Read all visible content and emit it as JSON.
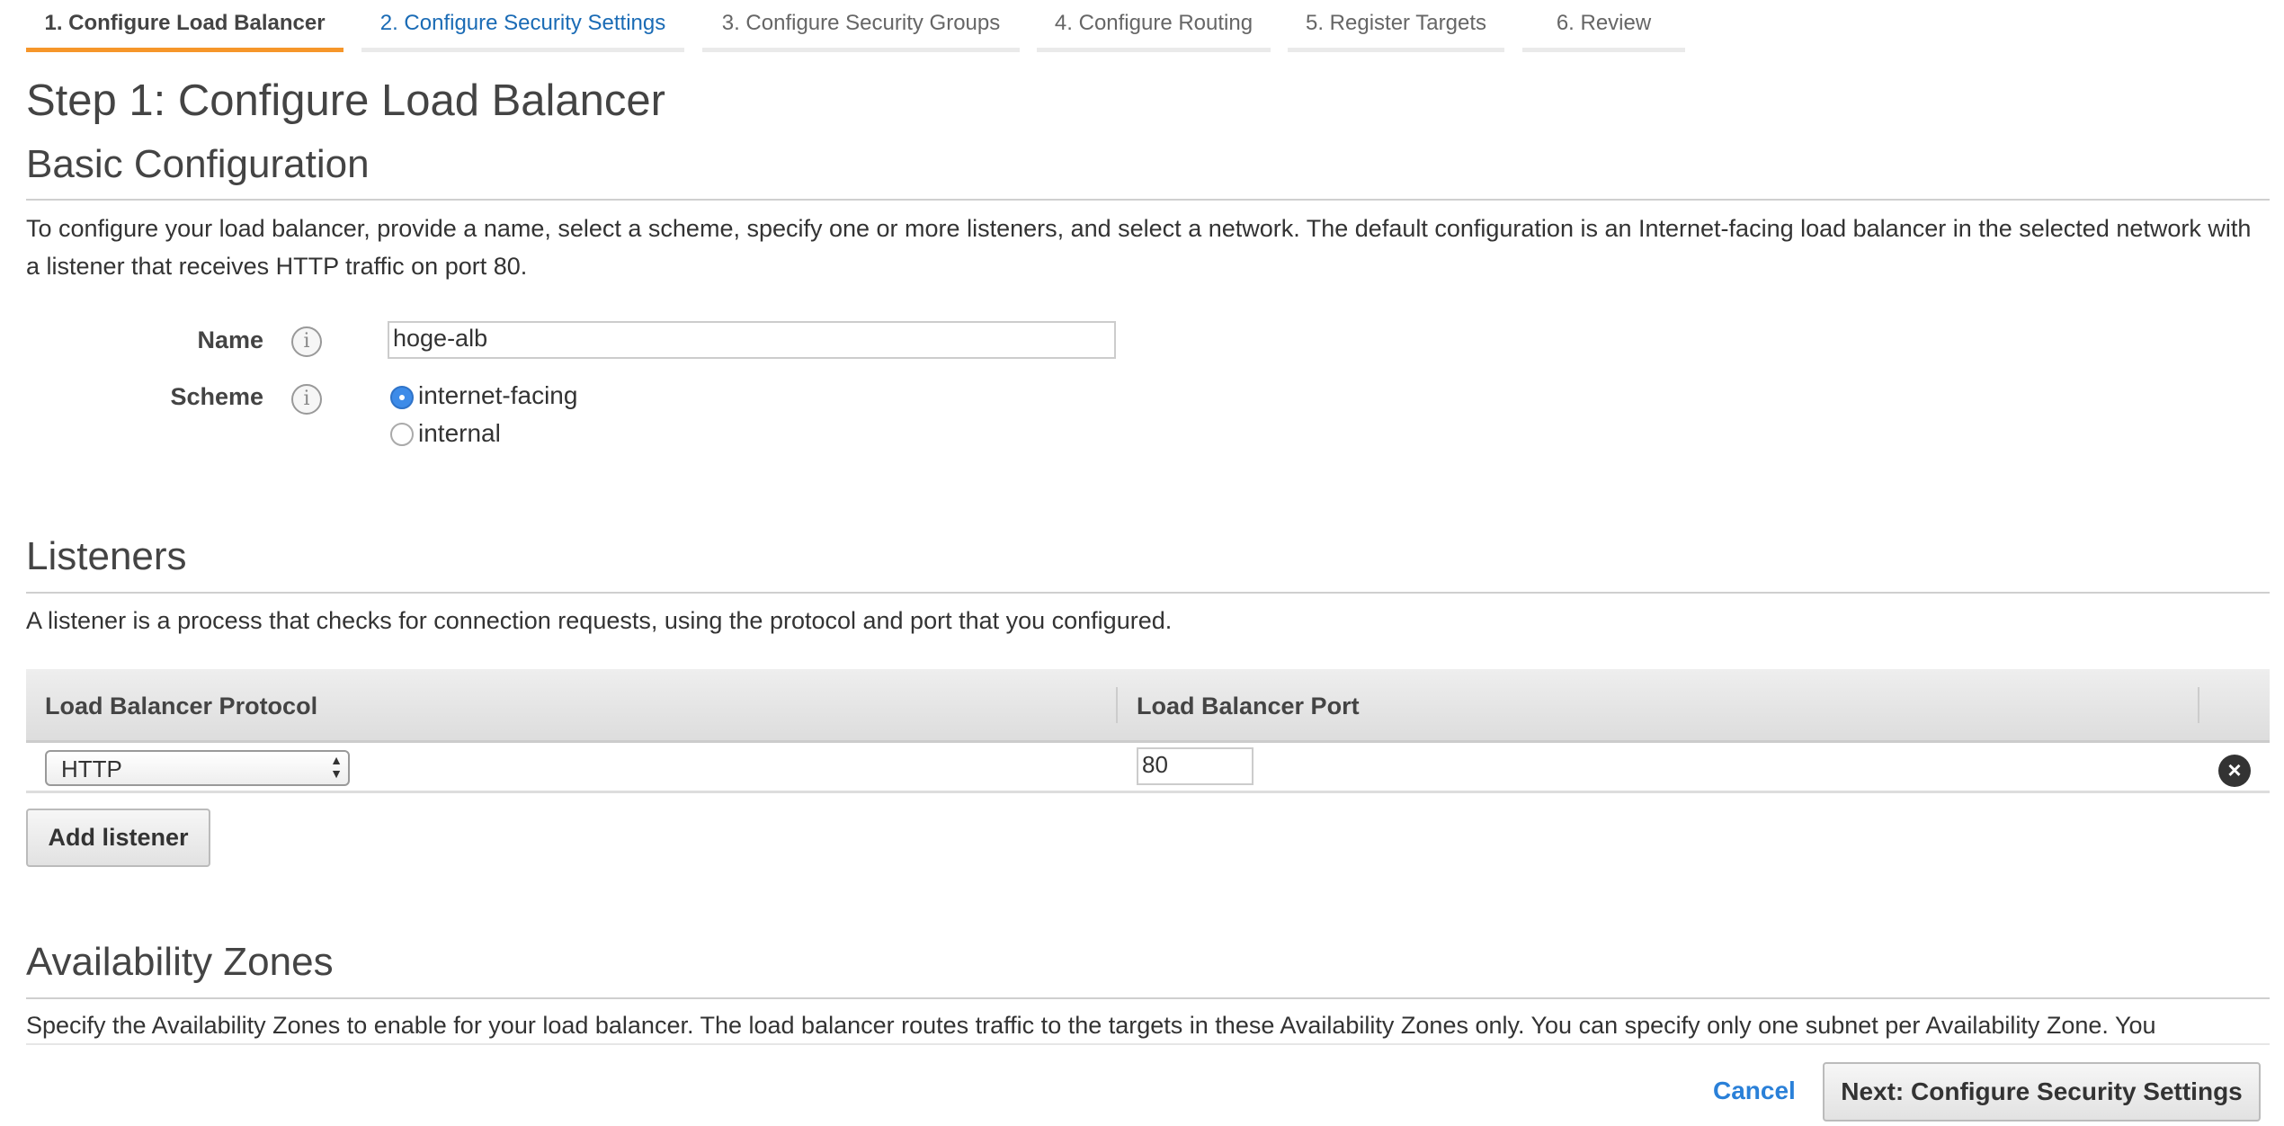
{
  "wizard_tabs": [
    {
      "label": "1. Configure Load Balancer",
      "state": "active"
    },
    {
      "label": "2. Configure Security Settings",
      "state": "next"
    },
    {
      "label": "3. Configure Security Groups",
      "state": "disabled"
    },
    {
      "label": "4. Configure Routing",
      "state": "disabled"
    },
    {
      "label": "5. Register Targets",
      "state": "disabled"
    },
    {
      "label": "6. Review",
      "state": "disabled"
    }
  ],
  "page_title": "Step 1: Configure Load Balancer",
  "basic": {
    "heading": "Basic Configuration",
    "description": "To configure your load balancer, provide a name, select a scheme, specify one or more listeners, and select a network. The default configuration is an Internet-facing load balancer in the selected network with a listener that receives HTTP traffic on port 80.",
    "name_label": "Name",
    "name_value": "hoge-alb",
    "scheme_label": "Scheme",
    "scheme_options": [
      "internet-facing",
      "internal"
    ],
    "scheme_selected": "internet-facing",
    "info_icon": "i"
  },
  "listeners": {
    "heading": "Listeners",
    "description": "A listener is a process that checks for connection requests, using the protocol and port that you configured.",
    "columns": [
      "Load Balancer Protocol",
      "Load Balancer Port"
    ],
    "rows": [
      {
        "protocol": "HTTP",
        "port": "80"
      }
    ],
    "add_label": "Add listener",
    "remove_icon": "×"
  },
  "az": {
    "heading": "Availability Zones",
    "description": "Specify the Availability Zones to enable for your load balancer. The load balancer routes traffic to the targets in these Availability Zones only. You can specify only one subnet per Availability Zone. You"
  },
  "footer": {
    "cancel": "Cancel",
    "next": "Next: Configure Security Settings"
  },
  "colors": {
    "accent": "#f6962a",
    "link": "#1a6bb5",
    "radio": "#3d8be8"
  }
}
